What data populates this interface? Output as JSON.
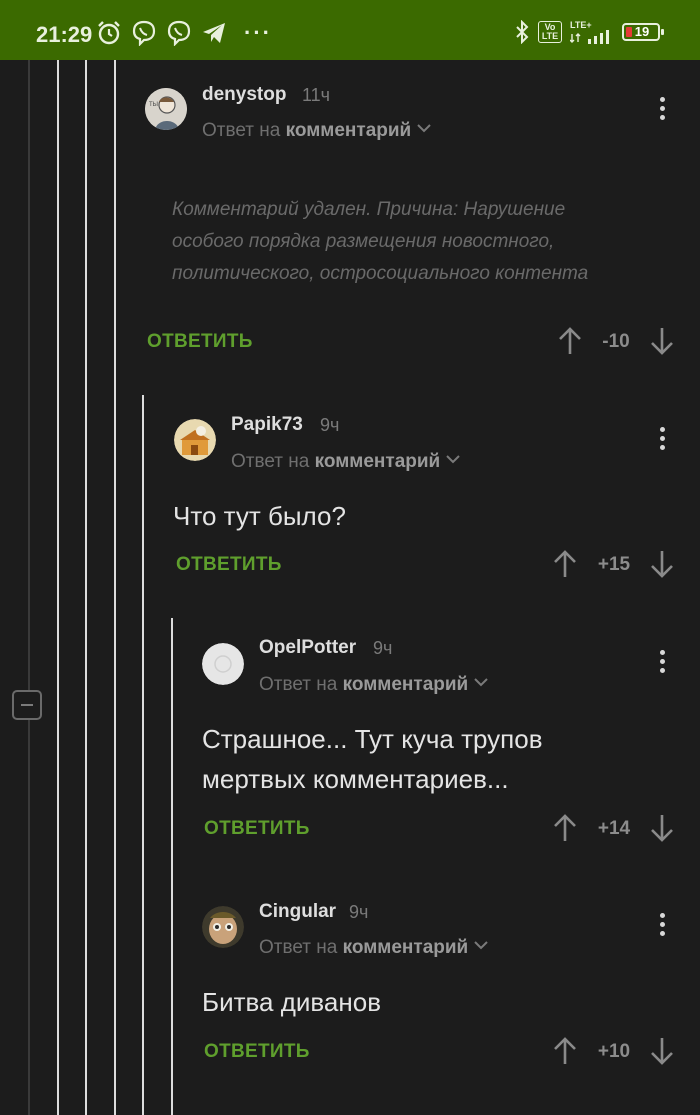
{
  "status_bar": {
    "time": "21:29",
    "lte_label": "Vo LTE",
    "lte_plus": "LTE+",
    "battery": "19",
    "battery_level": 0.19
  },
  "comments": [
    {
      "username": "denystop",
      "time": "11ч",
      "reply_prefix": "Ответ на",
      "reply_target": "комментарий",
      "deleted_text": "Комментарий удален. Причина: Нарушение особого порядка размещения новостного, политического, остросоциального контента",
      "reply_label": "ОТВЕТИТЬ",
      "score": "-10"
    },
    {
      "username": "Papik73",
      "time": "9ч",
      "reply_prefix": "Ответ на",
      "reply_target": "комментарий",
      "text": "Что тут было?",
      "reply_label": "ОТВЕТИТЬ",
      "score": "+15"
    },
    {
      "username": "OpelPotter",
      "time": "9ч",
      "reply_prefix": "Ответ на",
      "reply_target": "комментарий",
      "text": "Страшное... Тут куча трупов мертвых комментариев...",
      "reply_label": "ОТВЕТИТЬ",
      "score": "+14"
    },
    {
      "username": "Cingular",
      "time": "9ч",
      "reply_prefix": "Ответ на",
      "reply_target": "комментарий",
      "text": "Битва диванов",
      "reply_label": "ОТВЕТИТЬ",
      "score": "+10"
    }
  ]
}
